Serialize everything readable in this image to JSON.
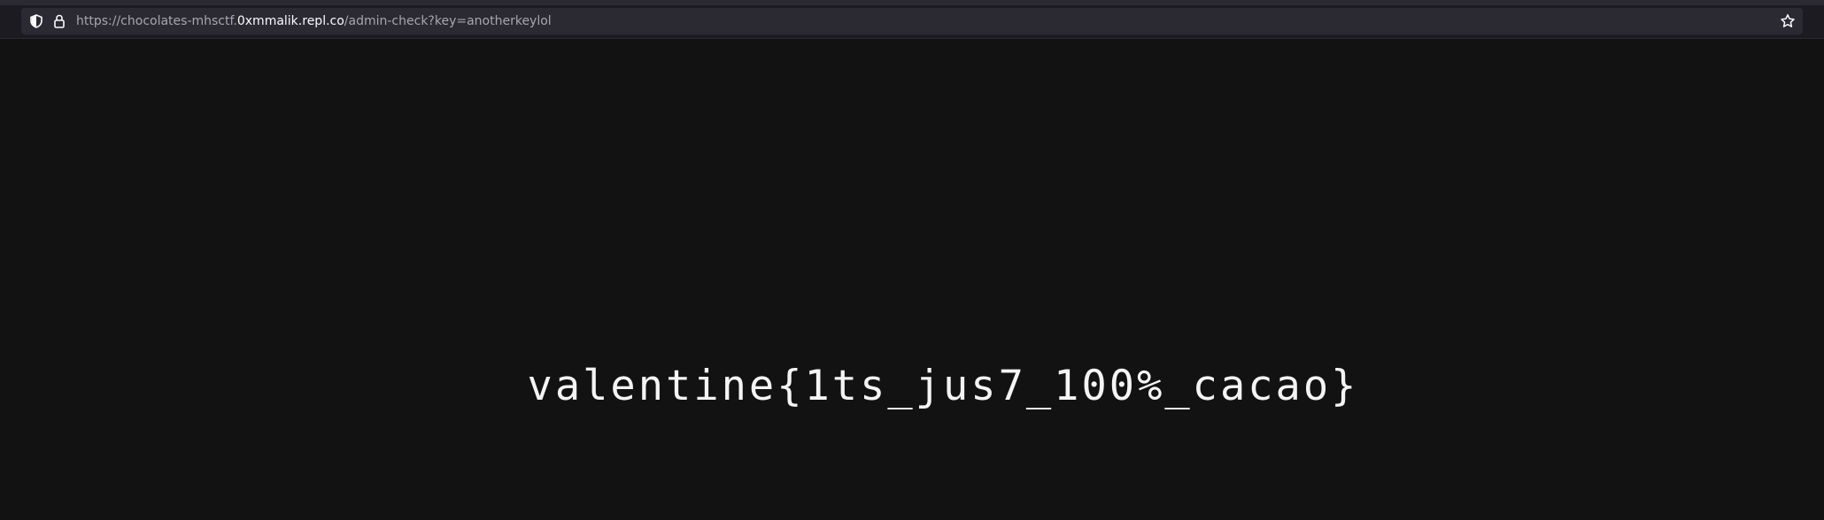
{
  "browser": {
    "url": {
      "prefix": "https://chocolates-mhsctf.",
      "domain": "0xmmalik.repl.co",
      "path": "/admin-check?key=anotherkeylol"
    },
    "icons": {
      "left": [
        "shield-icon",
        "lock-icon"
      ],
      "right": [
        "star-icon"
      ]
    }
  },
  "page": {
    "flag": "valentine{1ts_jus7_100%_cacao}"
  },
  "colors": {
    "background": "#121212",
    "chrome": "#1c1b22",
    "url_bar": "#2b2a33",
    "url_dim": "#a7a6ad",
    "url_bright": "#fbfbfe",
    "text": "#f4f4f4"
  }
}
